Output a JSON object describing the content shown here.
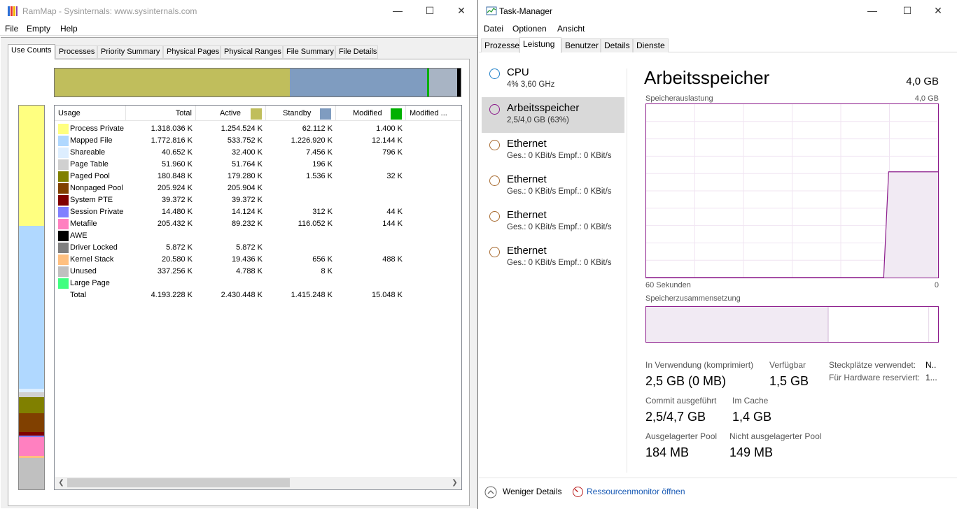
{
  "rammap": {
    "title": "RamMap - Sysinternals: www.sysinternals.com",
    "menu": [
      "File",
      "Empty",
      "Help"
    ],
    "tabs": [
      "Use Counts",
      "Processes",
      "Priority Summary",
      "Physical Pages",
      "Physical Ranges",
      "File Summary",
      "File Details"
    ],
    "active_tab": "Use Counts",
    "overview_bar": [
      {
        "name": "Active",
        "fraction": 0.58,
        "color": "#c0be5c"
      },
      {
        "name": "Standby",
        "fraction": 0.338,
        "color": "#7f9cc0"
      },
      {
        "name": "Modified",
        "fraction": 0.004,
        "color": "#00b000"
      },
      {
        "name": "Modified no write",
        "fraction": 0.07,
        "color": "#a8b4c4"
      },
      {
        "name": "Free",
        "fraction": 0.008,
        "color": "#000000"
      }
    ],
    "vertical_bar": [
      {
        "name": "Process Private",
        "fraction": 0.314,
        "color": "#ffff80"
      },
      {
        "name": "Mapped File",
        "fraction": 0.423,
        "color": "#b0d8ff"
      },
      {
        "name": "Shareable",
        "fraction": 0.01,
        "color": "#ddeeff"
      },
      {
        "name": "Page Table",
        "fraction": 0.012,
        "color": "#d0d0d0"
      },
      {
        "name": "Paged Pool",
        "fraction": 0.043,
        "color": "#808000"
      },
      {
        "name": "Nonpaged Pool",
        "fraction": 0.049,
        "color": "#804000"
      },
      {
        "name": "System PTE",
        "fraction": 0.009,
        "color": "#800000"
      },
      {
        "name": "Session Private",
        "fraction": 0.003,
        "color": "#8080ff"
      },
      {
        "name": "Metafile",
        "fraction": 0.049,
        "color": "#ff80c0"
      },
      {
        "name": "Driver Locked",
        "fraction": 0.001,
        "color": "#808080"
      },
      {
        "name": "Kernel Stack",
        "fraction": 0.005,
        "color": "#ffc080"
      },
      {
        "name": "Unused",
        "fraction": 0.082,
        "color": "#c0c0c0"
      }
    ],
    "columns": {
      "usage": "Usage",
      "total": "Total",
      "active": "Active",
      "standby": "Standby",
      "modified": "Modified",
      "modified_nw": "Modified ...",
      "active_color": "#c0be5c",
      "standby_color": "#7f9cc0",
      "modified_color": "#00b000"
    },
    "rows": [
      {
        "name": "Process Private",
        "color": "#ffff80",
        "total": "1.318.036 K",
        "active": "1.254.524 K",
        "standby": "62.112 K",
        "modified": "1.400 K"
      },
      {
        "name": "Mapped File",
        "color": "#b0d8ff",
        "total": "1.772.816 K",
        "active": "533.752 K",
        "standby": "1.226.920 K",
        "modified": "12.144 K"
      },
      {
        "name": "Shareable",
        "color": "#ddeeff",
        "total": "40.652 K",
        "active": "32.400 K",
        "standby": "7.456 K",
        "modified": "796 K"
      },
      {
        "name": "Page Table",
        "color": "#d0d0d0",
        "total": "51.960 K",
        "active": "51.764 K",
        "standby": "196 K",
        "modified": ""
      },
      {
        "name": "Paged Pool",
        "color": "#808000",
        "total": "180.848 K",
        "active": "179.280 K",
        "standby": "1.536 K",
        "modified": "32 K"
      },
      {
        "name": "Nonpaged Pool",
        "color": "#804000",
        "total": "205.924 K",
        "active": "205.904 K",
        "standby": "",
        "modified": ""
      },
      {
        "name": "System PTE",
        "color": "#800000",
        "total": "39.372 K",
        "active": "39.372 K",
        "standby": "",
        "modified": ""
      },
      {
        "name": "Session Private",
        "color": "#8080ff",
        "total": "14.480 K",
        "active": "14.124 K",
        "standby": "312 K",
        "modified": "44 K"
      },
      {
        "name": "Metafile",
        "color": "#ff80c0",
        "total": "205.432 K",
        "active": "89.232 K",
        "standby": "116.052 K",
        "modified": "144 K"
      },
      {
        "name": "AWE",
        "color": "#000000",
        "total": "",
        "active": "",
        "standby": "",
        "modified": ""
      },
      {
        "name": "Driver Locked",
        "color": "#808080",
        "total": "5.872 K",
        "active": "5.872 K",
        "standby": "",
        "modified": ""
      },
      {
        "name": "Kernel Stack",
        "color": "#ffc080",
        "total": "20.580 K",
        "active": "19.436 K",
        "standby": "656 K",
        "modified": "488 K"
      },
      {
        "name": "Unused",
        "color": "#c0c0c0",
        "total": "337.256 K",
        "active": "4.788 K",
        "standby": "8 K",
        "modified": ""
      },
      {
        "name": "Large Page",
        "color": "#40ff80",
        "total": "",
        "active": "",
        "standby": "",
        "modified": ""
      },
      {
        "name": "Total",
        "color": "",
        "total": "4.193.228 K",
        "active": "2.430.448 K",
        "standby": "1.415.248 K",
        "modified": "15.048 K"
      }
    ]
  },
  "taskman": {
    "title": "Task-Manager",
    "menu": [
      "Datei",
      "Optionen",
      "Ansicht"
    ],
    "tabs": [
      "Prozesse",
      "Leistung",
      "Benutzer",
      "Details",
      "Dienste"
    ],
    "active_tab": "Leistung",
    "sidebar": [
      {
        "title": "CPU",
        "sub": "4%  3,60 GHz",
        "color": "#1e7fc8",
        "selected": false
      },
      {
        "title": "Arbeitsspeicher",
        "sub": "2,5/4,0 GB (63%)",
        "color": "#8b1a8b",
        "selected": true
      },
      {
        "title": "Ethernet",
        "sub": "Ges.: 0 KBit/s  Empf.: 0 KBit/s",
        "color": "#a76a2f",
        "selected": false
      },
      {
        "title": "Ethernet",
        "sub": "Ges.: 0 KBit/s  Empf.: 0 KBit/s",
        "color": "#a76a2f",
        "selected": false
      },
      {
        "title": "Ethernet",
        "sub": "Ges.: 0 KBit/s  Empf.: 0 KBit/s",
        "color": "#a76a2f",
        "selected": false
      },
      {
        "title": "Ethernet",
        "sub": "Ges.: 0 KBit/s  Empf.: 0 KBit/s",
        "color": "#a76a2f",
        "selected": false
      }
    ],
    "header": {
      "title": "Arbeitsspeicher",
      "total": "4,0 GB"
    },
    "usage_chart": {
      "label": "Speicherauslastung",
      "max_label": "4,0 GB",
      "time_label": "60 Sekunden",
      "zero_label": "0",
      "accent": "#8b1a8b",
      "fill": "#f1eaf3",
      "history_fraction": [
        0,
        0,
        0,
        0,
        0,
        0,
        0,
        0,
        0,
        0,
        0,
        0,
        0,
        0,
        0,
        0,
        0,
        0,
        0,
        0,
        0,
        0,
        0,
        0,
        0,
        0,
        0,
        0,
        0,
        0,
        0,
        0,
        0,
        0,
        0,
        0,
        0,
        0,
        0,
        0,
        0,
        0,
        0,
        0,
        0,
        0,
        0,
        0,
        0,
        0.61,
        0.61,
        0.61,
        0.61,
        0.61,
        0.61,
        0.61,
        0.61,
        0.61,
        0.61,
        0.61
      ]
    },
    "composition": {
      "label": "Speicherzusammensetzung",
      "in_use_fraction": 0.623,
      "modified_fraction": 0.003,
      "standby_fraction": 0.343,
      "free_fraction": 0.031
    },
    "stats": {
      "in_use_label": "In Verwendung (komprimiert)",
      "in_use_value": "2,5 GB (0 MB)",
      "available_label": "Verfügbar",
      "available_value": "1,5 GB",
      "slots_label": "Steckplätze verwendet:",
      "slots_value": "N..",
      "hw_reserved_label": "Für Hardware reserviert:",
      "hw_reserved_value": "1...",
      "commit_label": "Commit ausgeführt",
      "commit_value": "2,5/4,7 GB",
      "cache_label": "Im Cache",
      "cache_value": "1,4 GB",
      "paged_pool_label": "Ausgelagerter Pool",
      "paged_pool_value": "184 MB",
      "nonpaged_pool_label": "Nicht ausgelagerter Pool",
      "nonpaged_pool_value": "149 MB"
    },
    "footer": {
      "less_details": "Weniger Details",
      "resource_monitor": "Ressourcenmonitor öffnen"
    }
  }
}
